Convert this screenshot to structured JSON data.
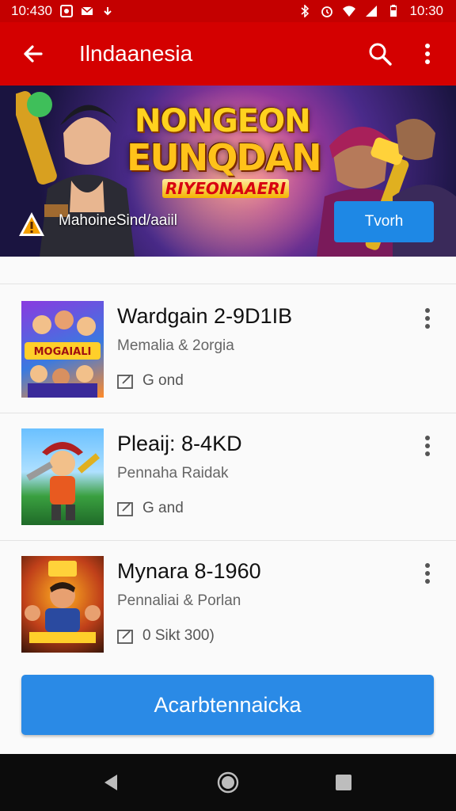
{
  "status_bar": {
    "left_time": "10:430",
    "right_time": "10:30"
  },
  "app_bar": {
    "title": "Ilndaanesia",
    "back_icon": "arrow-back-icon",
    "search_icon": "search-icon",
    "more_icon": "more-vert-icon"
  },
  "banner": {
    "title_line1": "NONGEON",
    "title_line2": "EUNQDAN",
    "tagline": "RIYEONAAERI",
    "subtitle": "MahoineSind/aaiil",
    "button_label": "Tvorh"
  },
  "games": [
    {
      "name": "Wardgain 2-9D1IB",
      "publisher": "Memalia & 2orgia",
      "meta": "G ond",
      "thumb_colors": [
        "#6a2bd0",
        "#ff9a1f"
      ]
    },
    {
      "name": "Pleaij: 8-4KD",
      "publisher": "Pennaha Raidak",
      "meta": "G and",
      "thumb_colors": [
        "#2a8a3a",
        "#8fd0ff"
      ]
    },
    {
      "name": "Mynara 8-1960",
      "publisher": "Pennaliai & Porlan",
      "meta": "0 Sikt 300)",
      "thumb_colors": [
        "#b23a10",
        "#ffb020"
      ]
    }
  ],
  "install_button": {
    "label": "Acarbtennaicka"
  },
  "colors": {
    "status_bar": "#c40000",
    "app_bar": "#d40000",
    "accent_blue": "#2a8ae6",
    "nav_bar": "#0c0c0c"
  }
}
